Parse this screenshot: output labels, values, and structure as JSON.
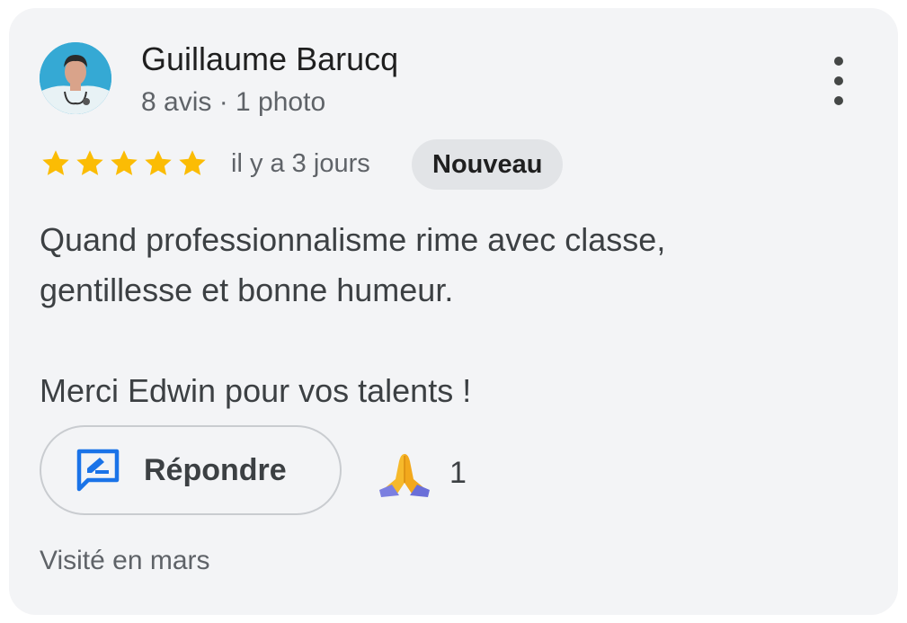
{
  "review": {
    "author_name": "Guillaume Barucq",
    "author_meta": "8 avis · 1 photo",
    "rating": 5,
    "rating_max": 5,
    "date": "il y a 3 jours",
    "badge": "Nouveau",
    "text_lines": [
      "Quand professionnalisme rime avec classe,",
      "gentillesse et bonne humeur.",
      "Merci Edwin pour vos talents !"
    ],
    "reply_label": "Répondre",
    "reaction_count": "1",
    "visit_text": "Visité en mars"
  },
  "colors": {
    "card_background": "#f3f4f6",
    "star": "#fbbc04",
    "reply_icon": "#1a73e8",
    "badge_background": "#e2e4e7"
  },
  "icons": {
    "more": "more-vert-icon",
    "star": "star-icon",
    "reply": "reply-icon",
    "reaction": "folded-hands-icon"
  }
}
